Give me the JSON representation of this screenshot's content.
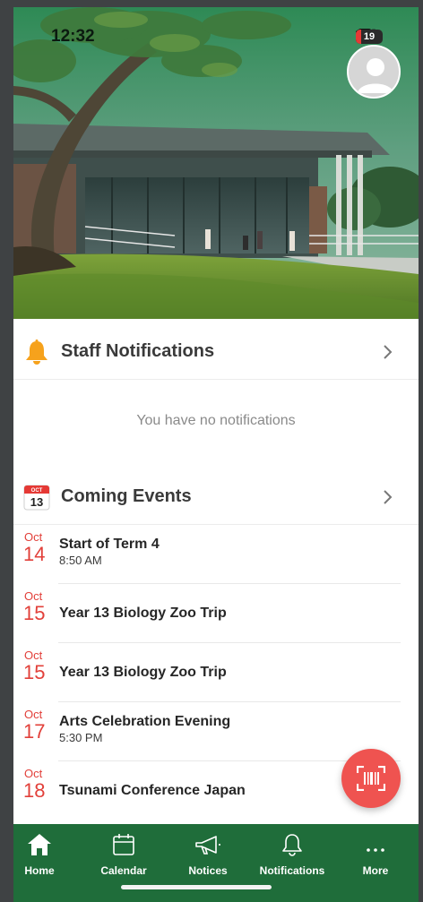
{
  "status_bar": {
    "time": "12:32",
    "battery_level": "19",
    "battery_fraction": 0.19
  },
  "colors": {
    "brand_green": "#1f6d3a",
    "accent_red": "#e2403a",
    "fab_red": "#ef5350"
  },
  "staff_notifications": {
    "title": "Staff Notifications",
    "empty_message": "You have no notifications",
    "icon": "bell-icon"
  },
  "coming_events": {
    "title": "Coming Events",
    "icon": "calendar-icon",
    "icon_month": "OCT",
    "icon_day": "13",
    "items": [
      {
        "month": "Oct",
        "day": "14",
        "name": "Start of Term 4",
        "time": "8:50 AM"
      },
      {
        "month": "Oct",
        "day": "15",
        "name": "Year 13 Biology Zoo Trip",
        "time": ""
      },
      {
        "month": "Oct",
        "day": "15",
        "name": "Year 13 Biology Zoo Trip",
        "time": ""
      },
      {
        "month": "Oct",
        "day": "17",
        "name": "Arts Celebration Evening",
        "time": "5:30 PM"
      },
      {
        "month": "Oct",
        "day": "18",
        "name": "Tsunami Conference Japan",
        "time": ""
      }
    ]
  },
  "fab": {
    "icon": "barcode-scan-icon"
  },
  "tabs": [
    {
      "label": "Home",
      "icon": "home-icon",
      "active": true
    },
    {
      "label": "Calendar",
      "icon": "calendar-icon",
      "active": false
    },
    {
      "label": "Notices",
      "icon": "megaphone-icon",
      "active": false
    },
    {
      "label": "Notifications",
      "icon": "bell-icon",
      "active": false
    },
    {
      "label": "More",
      "icon": "more-dots-icon",
      "active": false
    }
  ]
}
